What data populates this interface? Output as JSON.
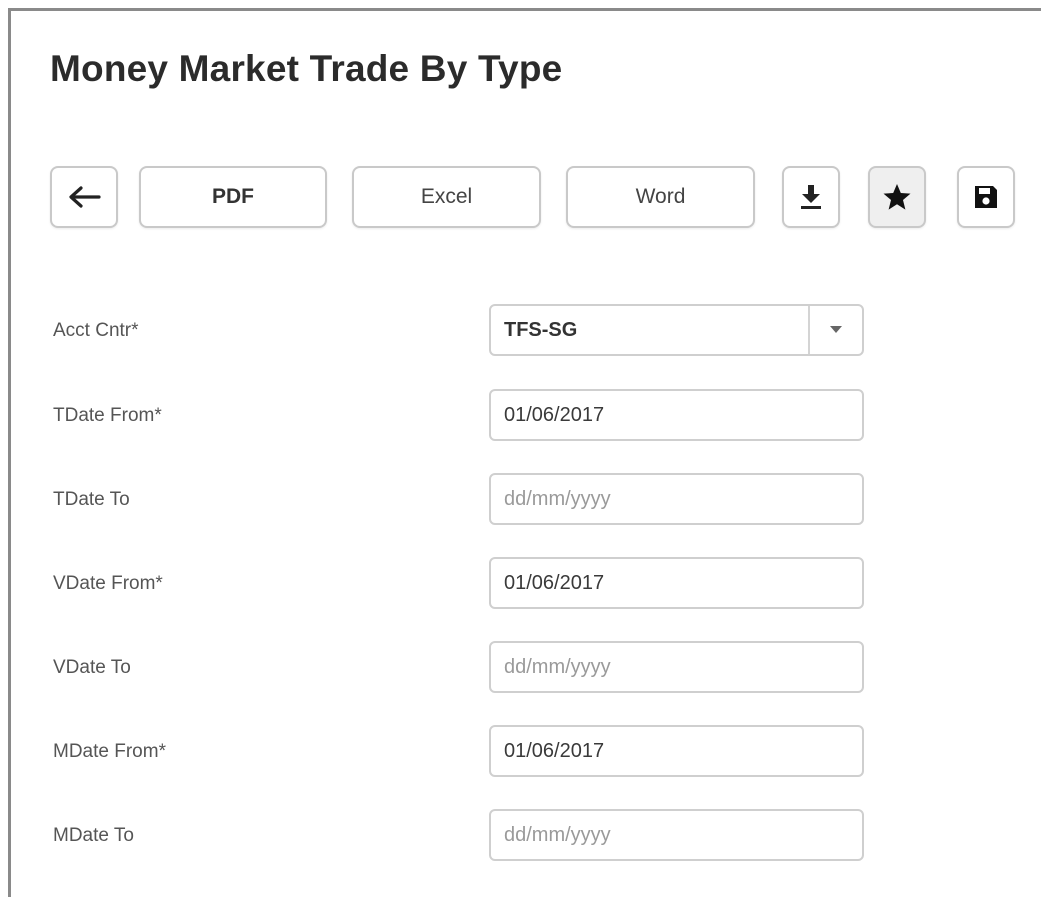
{
  "page": {
    "title": "Money Market Trade By Type"
  },
  "toolbar": {
    "back_icon": "arrow-left-icon",
    "pdf_label": "PDF",
    "excel_label": "Excel",
    "word_label": "Word",
    "download_icon": "download-icon",
    "favorite_icon": "star-icon",
    "save_icon": "floppy-disk-icon"
  },
  "form": {
    "fields": [
      {
        "label": "Acct Cntr*",
        "type": "select",
        "value": "TFS-SG",
        "icon": "caret-down-icon"
      },
      {
        "label": "TDate From*",
        "type": "date",
        "value": "01/06/2017",
        "placeholder": "dd/mm/yyyy"
      },
      {
        "label": "TDate To",
        "type": "date",
        "value": "",
        "placeholder": "dd/mm/yyyy"
      },
      {
        "label": "VDate From*",
        "type": "date",
        "value": "01/06/2017",
        "placeholder": "dd/mm/yyyy"
      },
      {
        "label": "VDate To",
        "type": "date",
        "value": "",
        "placeholder": "dd/mm/yyyy"
      },
      {
        "label": "MDate From*",
        "type": "date",
        "value": "01/06/2017",
        "placeholder": "dd/mm/yyyy"
      },
      {
        "label": "MDate To",
        "type": "date",
        "value": "",
        "placeholder": "dd/mm/yyyy"
      }
    ]
  },
  "colors": {
    "frame": "#8a8a8a",
    "text_dark": "#2b2b2b",
    "border": "#cfcfcf",
    "placeholder": "#9a9a9a"
  }
}
